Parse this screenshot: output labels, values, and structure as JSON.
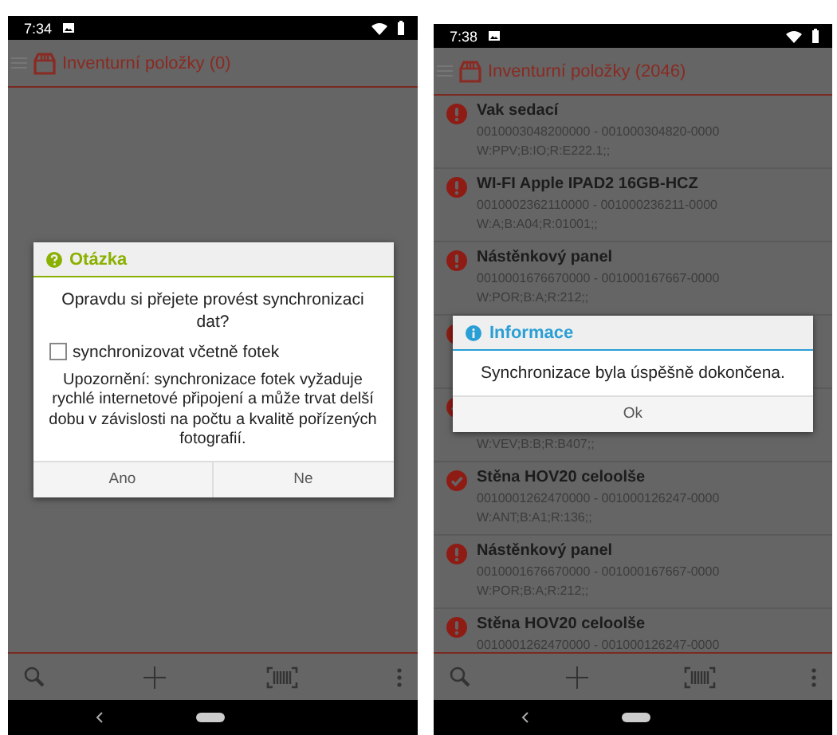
{
  "phones": [
    {
      "status_bar": {
        "time": "7:34"
      },
      "app_bar": {
        "title": "Inventurní položky (0)"
      },
      "dialog": {
        "kind": "question",
        "title": "Otázka",
        "message": "Opravdu si přejete provést synchronizaci dat?",
        "checkbox": {
          "label": "synchronizovat včetně fotek",
          "checked": false
        },
        "note": "Upozornění: synchronizace fotek vyžaduje rychlé internetové připojení a může trvat delší dobu v závislosti na počtu a kvalitě pořízených fotografií.",
        "buttons": [
          "Ano",
          "Ne"
        ]
      }
    },
    {
      "status_bar": {
        "time": "7:38"
      },
      "app_bar": {
        "title": "Inventurní položky (2046)"
      },
      "items": [
        {
          "kind": "error",
          "name": "Vak sedací",
          "code": "0010003048200000 - 001000304820-0000",
          "location": "W:PPV;B:IO;R:E222.1;;"
        },
        {
          "kind": "error",
          "name": "WI-FI Apple IPAD2 16GB-HCZ",
          "code": "0010002362110000 - 001000236211-0000",
          "location": "W:A;B:A04;R:01001;;"
        },
        {
          "kind": "error",
          "name": "Nástěnkový panel",
          "code": "0010001676670000 - 001000167667-0000",
          "location": "W:POR;B:A;R:212;;"
        },
        {
          "kind": "error"
        },
        {
          "kind": "ok",
          "location": "W:VEV;B:B;R:B407;;"
        },
        {
          "kind": "ok",
          "name": "Stěna HOV20 celoolše",
          "code": "0010001262470000 - 001000126247-0000",
          "location": "W:ANT;B:A1;R:136;;"
        },
        {
          "kind": "error",
          "name": "Nástěnkový panel",
          "code": "0010001676670000 - 001000167667-0000",
          "location": "W:POR;B:A;R:212;;"
        },
        {
          "kind": "error",
          "name": "Stěna HOV20 celoolše",
          "code": "0010001262470000 - 001000126247-0000"
        }
      ],
      "dialog": {
        "kind": "info",
        "title": "Informace",
        "message": "Synchronizace byla úspěšně dokončena.",
        "buttons": [
          "Ok"
        ]
      }
    }
  ]
}
